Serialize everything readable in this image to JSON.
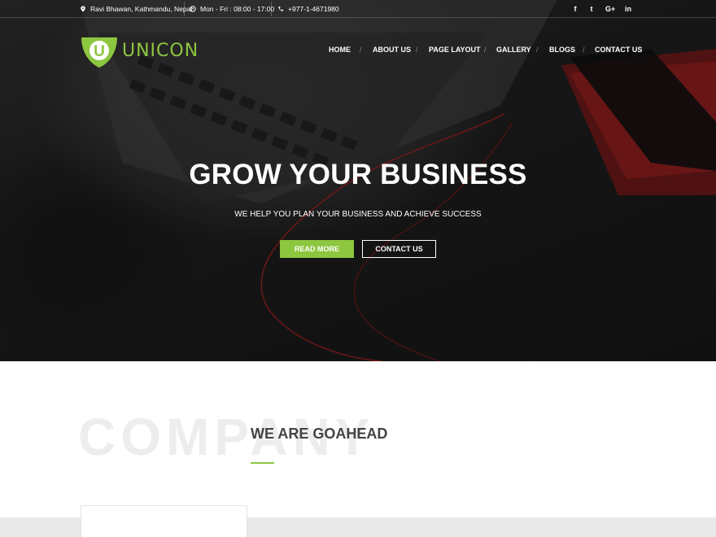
{
  "topbar": {
    "address": "Ravi Bhawan, Kathmandu, Nepal",
    "hours": "Mon - Fri : 08:00 - 17:00",
    "phone": "+977-1-4671980",
    "social": [
      "f",
      "t",
      "G+",
      "in"
    ]
  },
  "brand": {
    "name": "UNICON",
    "logo_letter": "U"
  },
  "nav": [
    "HOME",
    "ABOUT US",
    "PAGE LAYOUT",
    "GALLERY",
    "BLOGS",
    "CONTACT US"
  ],
  "hero": {
    "title": "GROW YOUR BUSINESS",
    "subtitle": "WE HELP YOU PLAN YOUR BUSINESS AND ACHIEVE SUCCESS",
    "read_more": "READ MORE",
    "contact": "CONTACT US"
  },
  "section": {
    "watermark": "COMPANY",
    "title": "WE ARE GOAHEAD"
  },
  "colors": {
    "accent": "#8dc63f",
    "title": "#444444"
  }
}
